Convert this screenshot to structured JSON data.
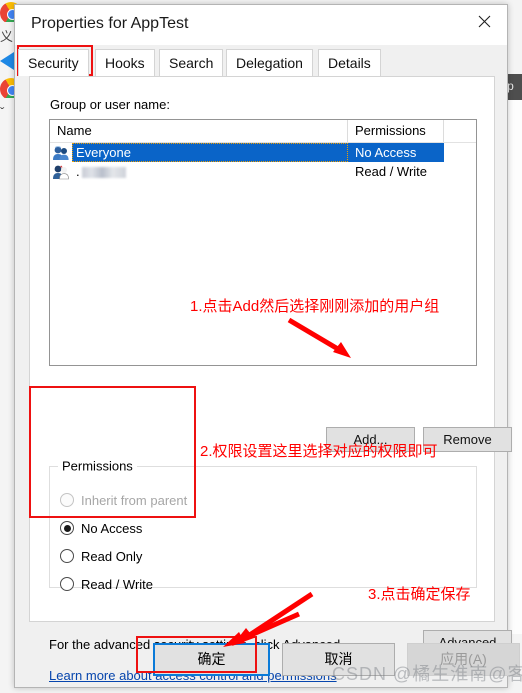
{
  "window": {
    "title": "Properties for AppTest",
    "close_icon": "close-icon"
  },
  "tabs": [
    {
      "label": "Security",
      "active": true
    },
    {
      "label": "Hooks",
      "active": false
    },
    {
      "label": "Search",
      "active": false
    },
    {
      "label": "Delegation",
      "active": false
    },
    {
      "label": "Details",
      "active": false
    }
  ],
  "security": {
    "group_label": "Group or user name:",
    "columns": {
      "name": "Name",
      "permissions": "Permissions"
    },
    "rows": [
      {
        "name": "Everyone",
        "permission": "No Access",
        "selected": true,
        "blurred": false
      },
      {
        "name": ".",
        "permission": "Read / Write",
        "selected": false,
        "blurred": true
      }
    ],
    "add_button": "Add...",
    "remove_button": "Remove",
    "permissions_group": {
      "legend": "Permissions",
      "options": [
        {
          "label": "Inherit from parent",
          "selected": false,
          "disabled": true
        },
        {
          "label": "No Access",
          "selected": true,
          "disabled": false
        },
        {
          "label": "Read Only",
          "selected": false,
          "disabled": false
        },
        {
          "label": "Read / Write",
          "selected": false,
          "disabled": false
        }
      ]
    },
    "advanced_text": "For the advanced security settings, click Advanced.",
    "advanced_button": "Advanced",
    "learn_link": "Learn more about access control and permissions"
  },
  "footer": {
    "ok": "确定",
    "cancel": "取消",
    "apply": "应用(A)"
  },
  "annotations": [
    {
      "id": 1,
      "text": "1.点击Add然后选择刚刚添加的用户组"
    },
    {
      "id": 2,
      "text": "2.权限设置这里选择对应的权限即可"
    },
    {
      "id": 3,
      "text": "3.点击确定保存"
    }
  ],
  "watermark": "CSDN @橘生淮南@客",
  "background": {
    "right_window_title": "op"
  },
  "colors": {
    "annotation_red": "#ff0000",
    "selection_blue": "#0a64c8",
    "focus_blue": "#0a7ad8",
    "link_blue": "#0645ad"
  }
}
